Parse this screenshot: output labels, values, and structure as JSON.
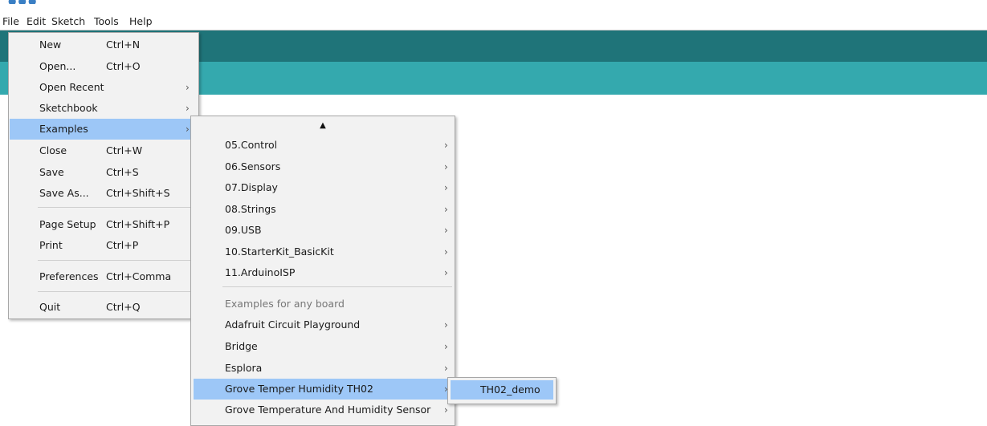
{
  "menubar": {
    "items": [
      {
        "label": "File"
      },
      {
        "label": "Edit"
      },
      {
        "label": "Sketch"
      },
      {
        "label": "Tools"
      },
      {
        "label": "Help"
      }
    ]
  },
  "file_menu": {
    "items": [
      {
        "label": "New",
        "shortcut": "Ctrl+N"
      },
      {
        "label": "Open...",
        "shortcut": "Ctrl+O"
      },
      {
        "label": "Open Recent",
        "submenu": true
      },
      {
        "label": "Sketchbook",
        "submenu": true
      },
      {
        "label": "Examples",
        "submenu": true,
        "highlighted": true
      },
      {
        "label": "Close",
        "shortcut": "Ctrl+W"
      },
      {
        "label": "Save",
        "shortcut": "Ctrl+S"
      },
      {
        "label": "Save As...",
        "shortcut": "Ctrl+Shift+S"
      },
      {
        "label": "Page Setup",
        "shortcut": "Ctrl+Shift+P"
      },
      {
        "label": "Print",
        "shortcut": "Ctrl+P"
      },
      {
        "label": "Preferences",
        "shortcut": "Ctrl+Comma"
      },
      {
        "label": "Quit",
        "shortcut": "Ctrl+Q"
      }
    ]
  },
  "examples_menu": {
    "scroll_up_glyph": "▲",
    "items": [
      {
        "label": "05.Control"
      },
      {
        "label": "06.Sensors"
      },
      {
        "label": "07.Display"
      },
      {
        "label": "08.Strings"
      },
      {
        "label": "09.USB"
      },
      {
        "label": "10.StarterKit_BasicKit"
      },
      {
        "label": "11.ArduinoISP"
      }
    ],
    "group_header": "Examples for any board",
    "board_items": [
      {
        "label": "Adafruit Circuit Playground"
      },
      {
        "label": "Bridge"
      },
      {
        "label": "Esplora"
      },
      {
        "label": "Grove Temper Humidity TH02",
        "highlighted": true
      },
      {
        "label": "Grove Temperature And Humidity Sensor"
      }
    ]
  },
  "th02_submenu": {
    "items": [
      {
        "label": "TH02_demo",
        "highlighted": true
      }
    ]
  },
  "glyphs": {
    "submenu_arrow": "›"
  },
  "colors": {
    "toolbar_dark": "#1f7479",
    "toolbar_light": "#34a9ae",
    "highlight": "#9dc7f7",
    "menu_bg": "#f2f2f2"
  }
}
